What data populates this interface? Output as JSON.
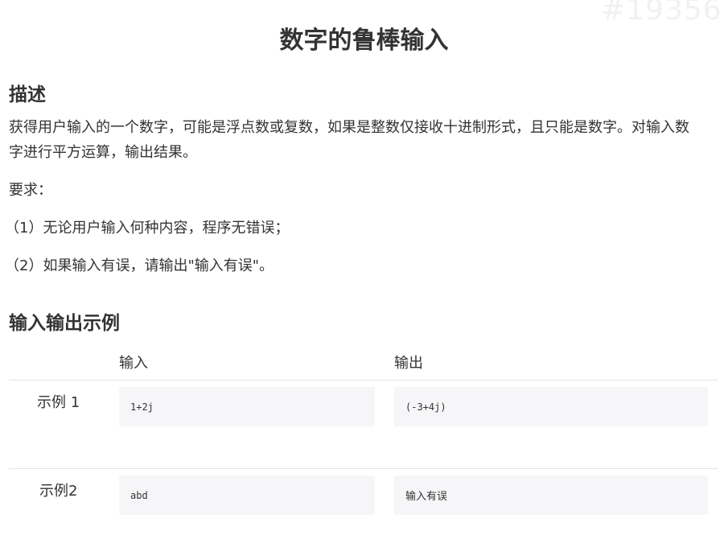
{
  "watermark": "#19356",
  "title": "数字的鲁棒输入",
  "description": {
    "heading": "描述",
    "line1": "获得用户输入的一个数字，可能是浮点数或复数，如果是整数仅接收十进制形式，且只能是数字。对输入数",
    "line2": "字进行平方运算，输出结果。",
    "requirements_label": "要求：",
    "req1": "（1）无论用户输入何种内容，程序无错误；",
    "req2": "（2）如果输入有误，请输出\"输入有误\"。"
  },
  "examples": {
    "heading": "输入输出示例",
    "input_header": "输入",
    "output_header": "输出",
    "rows": [
      {
        "label": "示例 1",
        "input": "1+2j",
        "output": "(-3+4j)"
      },
      {
        "label": "示例2",
        "input": "abd",
        "output": "输入有误"
      }
    ]
  }
}
